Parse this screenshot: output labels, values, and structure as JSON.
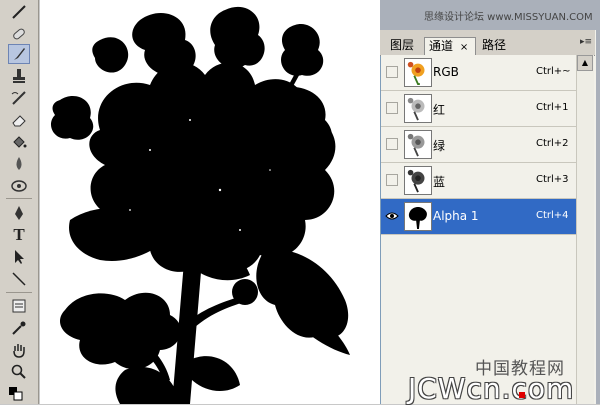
{
  "watermark": {
    "top": "思缘设计论坛  www.MISSYUAN.COM",
    "bottom_cn": "中国教程网",
    "bottom_en": "JCWcn.com"
  },
  "panel": {
    "tabs": [
      {
        "label": "图层"
      },
      {
        "label": "通道"
      },
      {
        "label": "路径"
      }
    ],
    "tab_close": "×",
    "menu_icon": "▸≡",
    "channels": [
      {
        "name": "RGB",
        "shortcut": "Ctrl+~",
        "visible": false,
        "selected": false
      },
      {
        "name": "红",
        "shortcut": "Ctrl+1",
        "visible": false,
        "selected": false
      },
      {
        "name": "绿",
        "shortcut": "Ctrl+2",
        "visible": false,
        "selected": false
      },
      {
        "name": "蓝",
        "shortcut": "Ctrl+3",
        "visible": false,
        "selected": false
      },
      {
        "name": "Alpha 1",
        "shortcut": "Ctrl+4",
        "visible": true,
        "selected": true
      }
    ]
  },
  "colors": {
    "selection": "#316ac5",
    "panel_bg": "#f2f1ea",
    "toolbar_bg": "#d4d0c8"
  },
  "toolbar": {
    "tools": [
      "healing-brush-icon",
      "brush-icon",
      "stamp-icon",
      "history-brush-icon",
      "eraser-icon",
      "paint-bucket-icon",
      "blur-icon",
      "dodge-icon",
      "pen-icon",
      "type-icon",
      "path-select-icon",
      "line-icon",
      "notes-icon",
      "eyedropper-icon",
      "hand-icon",
      "zoom-icon"
    ],
    "type_glyph": "T"
  }
}
